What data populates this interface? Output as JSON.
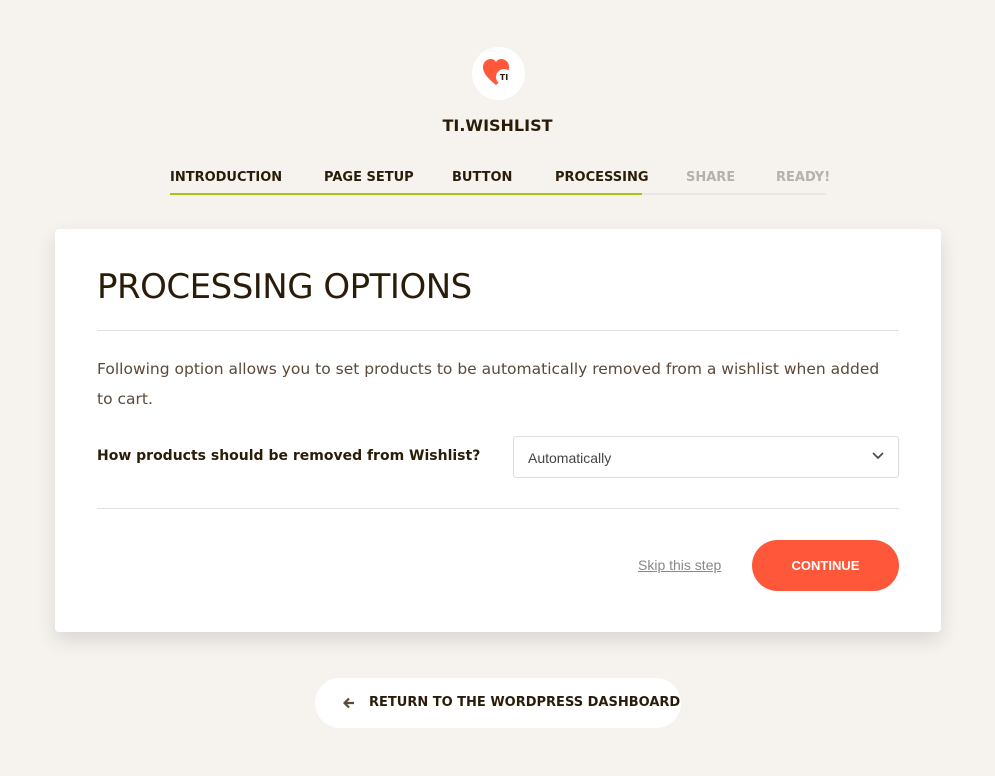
{
  "brand": {
    "name": "TI.WISHLIST",
    "logo_text": "TI",
    "accent": "#ff5739"
  },
  "steps": [
    {
      "label": "INTRODUCTION",
      "done": true
    },
    {
      "label": "PAGE SETUP",
      "done": true
    },
    {
      "label": "BUTTON",
      "done": true
    },
    {
      "label": "PROCESSING",
      "done": true,
      "current": true
    },
    {
      "label": "SHARE",
      "done": false
    },
    {
      "label": "READY!",
      "done": false
    }
  ],
  "progress_color": "#a9c212",
  "card": {
    "title": "PROCESSING OPTIONS",
    "description": "Following option allows you to set products to be automatically removed from a wishlist when added to cart.",
    "field_label": "How products should be removed from Wishlist?",
    "select_value": "Automatically",
    "skip_label": "Skip this step",
    "continue_label": "CONTINUE"
  },
  "return_label": "RETURN TO THE WORDPRESS DASHBOARD"
}
